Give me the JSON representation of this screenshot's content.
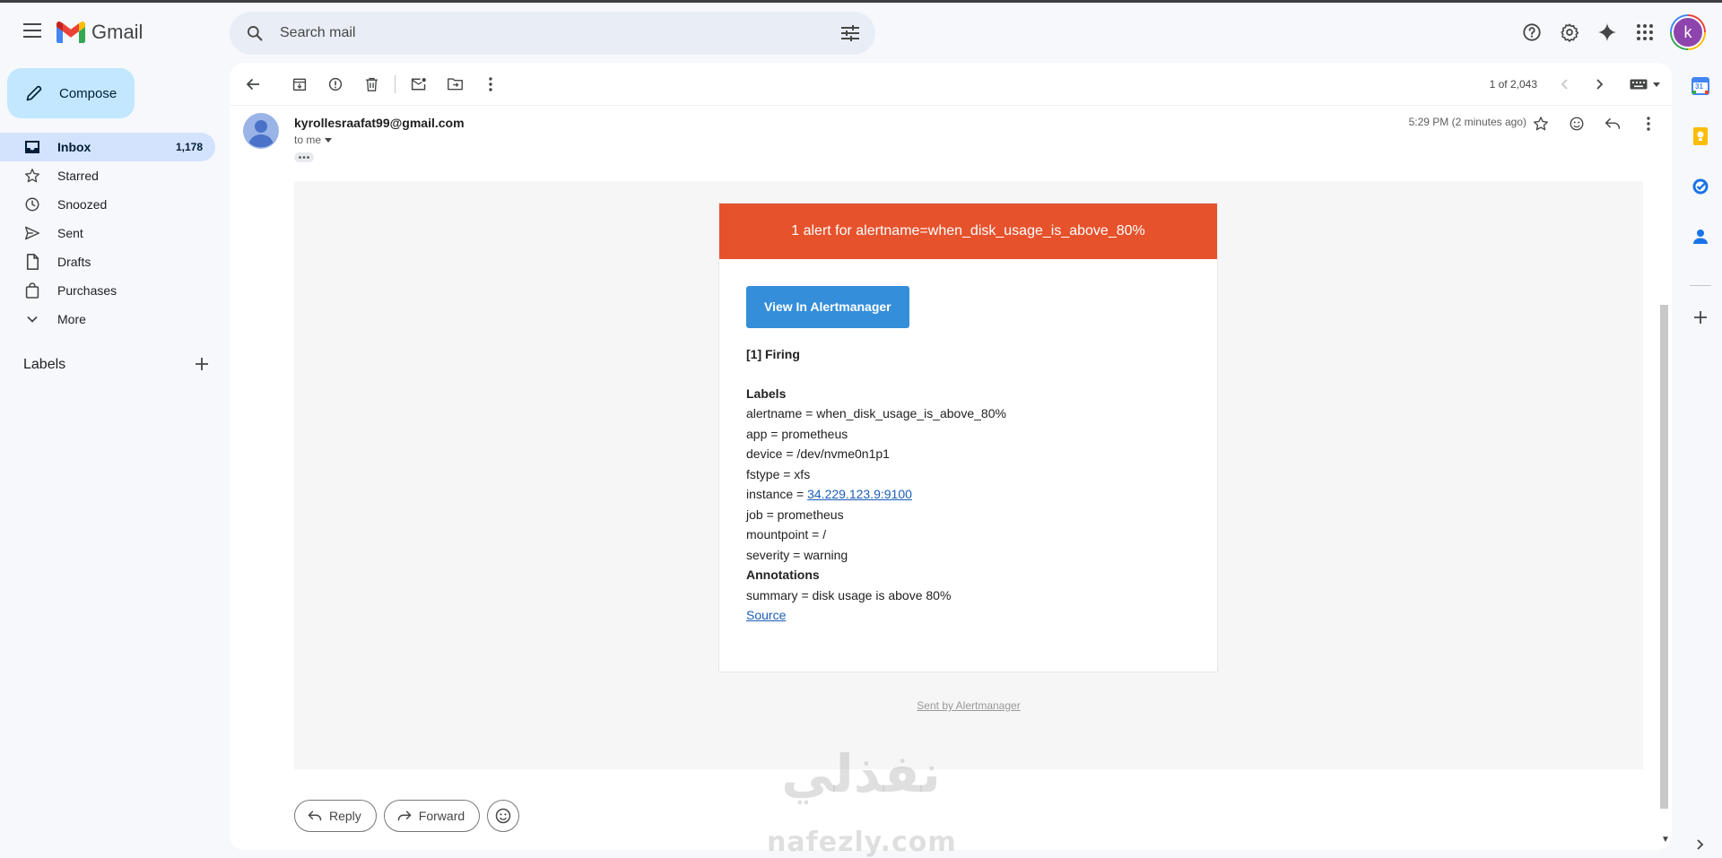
{
  "header": {
    "app_name": "Gmail",
    "search_placeholder": "Search mail",
    "avatar_letter": "k"
  },
  "sidebar": {
    "compose_label": "Compose",
    "items": [
      {
        "label": "Inbox",
        "count": "1,178",
        "icon": "inbox-icon",
        "active": true
      },
      {
        "label": "Starred",
        "count": "",
        "icon": "star-icon"
      },
      {
        "label": "Snoozed",
        "count": "",
        "icon": "clock-icon"
      },
      {
        "label": "Sent",
        "count": "",
        "icon": "send-icon"
      },
      {
        "label": "Drafts",
        "count": "",
        "icon": "draft-icon"
      },
      {
        "label": "Purchases",
        "count": "",
        "icon": "shopping-bag-icon"
      },
      {
        "label": "More",
        "count": "",
        "icon": "chevron-down-icon"
      }
    ],
    "labels_title": "Labels"
  },
  "toolbar": {
    "pager_text": "1 of 2,043"
  },
  "message": {
    "sender": "kyrollesraafat99@gmail.com",
    "to": "to me",
    "time": "5:29 PM (2 minutes ago)"
  },
  "email": {
    "banner": "1 alert for alertname=when_disk_usage_is_above_80%",
    "button_label": "View In Alertmanager",
    "firing": "[1] Firing",
    "labels_heading": "Labels",
    "labels": {
      "alertname": "alertname = when_disk_usage_is_above_80%",
      "app": "app = prometheus",
      "device": "device = /dev/nvme0n1p1",
      "fstype": "fstype = xfs",
      "instance_prefix": "instance = ",
      "instance_link": "34.229.123.9:9100",
      "job": "job = prometheus",
      "mountpoint": "mountpoint = /",
      "severity": "severity = warning"
    },
    "annotations_heading": "Annotations",
    "summary": "summary = disk usage is above 80%",
    "source_link": "Source",
    "sent_by": "Sent by Alertmanager"
  },
  "reply_bar": {
    "reply_label": "Reply",
    "forward_label": "Forward"
  },
  "side_panel": {
    "calendar_day": "31"
  },
  "watermark": {
    "arabic": "نفذلي",
    "latin": "nafezly.com"
  },
  "colors": {
    "accent": "#0b57d0",
    "compose_bg": "#c2e7ff",
    "active_nav": "#d3e3fd",
    "alert_banner": "#e6522c",
    "alertmanager_button": "#348eda"
  }
}
